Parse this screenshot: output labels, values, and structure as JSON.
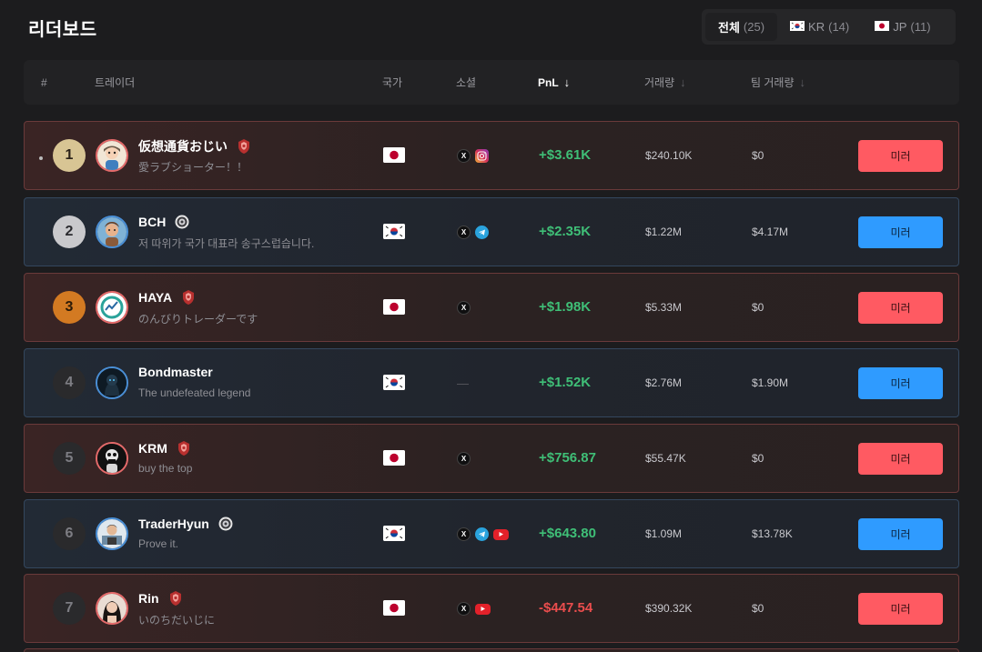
{
  "page": {
    "title": "리더보드"
  },
  "filters": [
    {
      "label": "전체",
      "count": "(25)",
      "flag": "",
      "active": true
    },
    {
      "label": "KR",
      "count": "(14)",
      "flag": "kr",
      "active": false
    },
    {
      "label": "JP",
      "count": "(11)",
      "flag": "jp",
      "active": false
    }
  ],
  "columns": {
    "rank": "#",
    "trader": "트레이더",
    "country": "국가",
    "social": "소셜",
    "pnl": "PnL",
    "volume": "거래량",
    "team_volume": "팀 거래량",
    "sort_arrow": "↓"
  },
  "rows": [
    {
      "rank": "1",
      "name": "仮想通貨おじい",
      "bio": "愛ラブショーター！！",
      "country": "jp",
      "socials": [
        "x",
        "instagram"
      ],
      "pnl": "+$3.61K",
      "pnl_sign": "pos",
      "volume": "$240.10K",
      "team_volume": "$0",
      "button": "미러"
    },
    {
      "rank": "2",
      "name": "BCH",
      "bio": "저 따위가 국가 대표라 송구스럽습니다.",
      "country": "kr",
      "socials": [
        "x",
        "telegram"
      ],
      "pnl": "+$2.35K",
      "pnl_sign": "pos",
      "volume": "$1.22M",
      "team_volume": "$4.17M",
      "button": "미러"
    },
    {
      "rank": "3",
      "name": "HAYA",
      "bio": "のんびりトレーダーです",
      "country": "jp",
      "socials": [
        "x"
      ],
      "pnl": "+$1.98K",
      "pnl_sign": "pos",
      "volume": "$5.33M",
      "team_volume": "$0",
      "button": "미러"
    },
    {
      "rank": "4",
      "name": "Bondmaster",
      "bio": "The undefeated legend",
      "country": "kr",
      "socials": [],
      "empty_social": "—",
      "pnl": "+$1.52K",
      "pnl_sign": "pos",
      "volume": "$2.76M",
      "team_volume": "$1.90M",
      "button": "미러"
    },
    {
      "rank": "5",
      "name": "KRM",
      "bio": "buy the top",
      "country": "jp",
      "socials": [
        "x"
      ],
      "pnl": "+$756.87",
      "pnl_sign": "pos",
      "volume": "$55.47K",
      "team_volume": "$0",
      "button": "미러"
    },
    {
      "rank": "6",
      "name": "TraderHyun",
      "bio": "Prove it.",
      "country": "kr",
      "socials": [
        "x",
        "telegram",
        "youtube"
      ],
      "pnl": "+$643.80",
      "pnl_sign": "pos",
      "volume": "$1.09M",
      "team_volume": "$13.78K",
      "button": "미러"
    },
    {
      "rank": "7",
      "name": "Rin",
      "bio": "いのちだいじに",
      "country": "jp",
      "socials": [
        "x",
        "youtube"
      ],
      "pnl": "-$447.54",
      "pnl_sign": "neg",
      "volume": "$390.32K",
      "team_volume": "$0",
      "button": "미러"
    }
  ],
  "colors": {
    "jp_accent": "#ff5a62",
    "kr_accent": "#2f9bff",
    "positive": "#3fbf77",
    "negative": "#ea4d4d"
  }
}
